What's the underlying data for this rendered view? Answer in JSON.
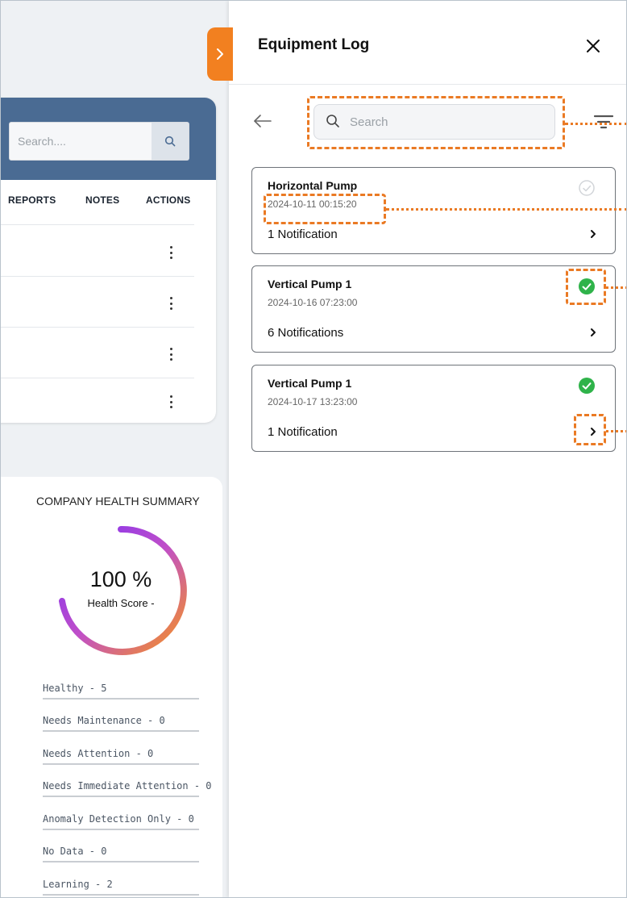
{
  "left_panel": {
    "search": {
      "placeholder": "Search...."
    },
    "columns": [
      "REPORTS",
      "NOTES",
      "ACTIONS"
    ],
    "row_count": 4
  },
  "health_summary": {
    "title": "COMPANY HEALTH SUMMARY",
    "score": "100 %",
    "score_label": "Health Score -",
    "score_value": 100,
    "stats": [
      "Healthy - 5",
      "Needs Maintenance - 0",
      "Needs Attention - 0",
      "Needs Immediate Attention - 0",
      "Anomaly Detection Only - 0",
      "No Data - 0",
      "Learning - 2"
    ]
  },
  "panel": {
    "title": "Equipment Log",
    "search": {
      "placeholder": "Search"
    },
    "cards": [
      {
        "name": "Horizontal Pump",
        "timestamp": "2024-10-11 00:15:20",
        "notifications": "1 Notification",
        "status": "inactive"
      },
      {
        "name": "Vertical Pump 1",
        "timestamp": "2024-10-16 07:23:00",
        "notifications": "6 Notifications",
        "status": "healthy"
      },
      {
        "name": "Vertical Pump 1",
        "timestamp": "2024-10-17 13:23:00",
        "notifications": "1 Notification",
        "status": "healthy"
      }
    ]
  },
  "colors": {
    "accent_orange": "#f28020",
    "header_blue": "#4a6b93",
    "healthy_green": "#2fb34a",
    "annotation_orange": "#ea7a24"
  }
}
